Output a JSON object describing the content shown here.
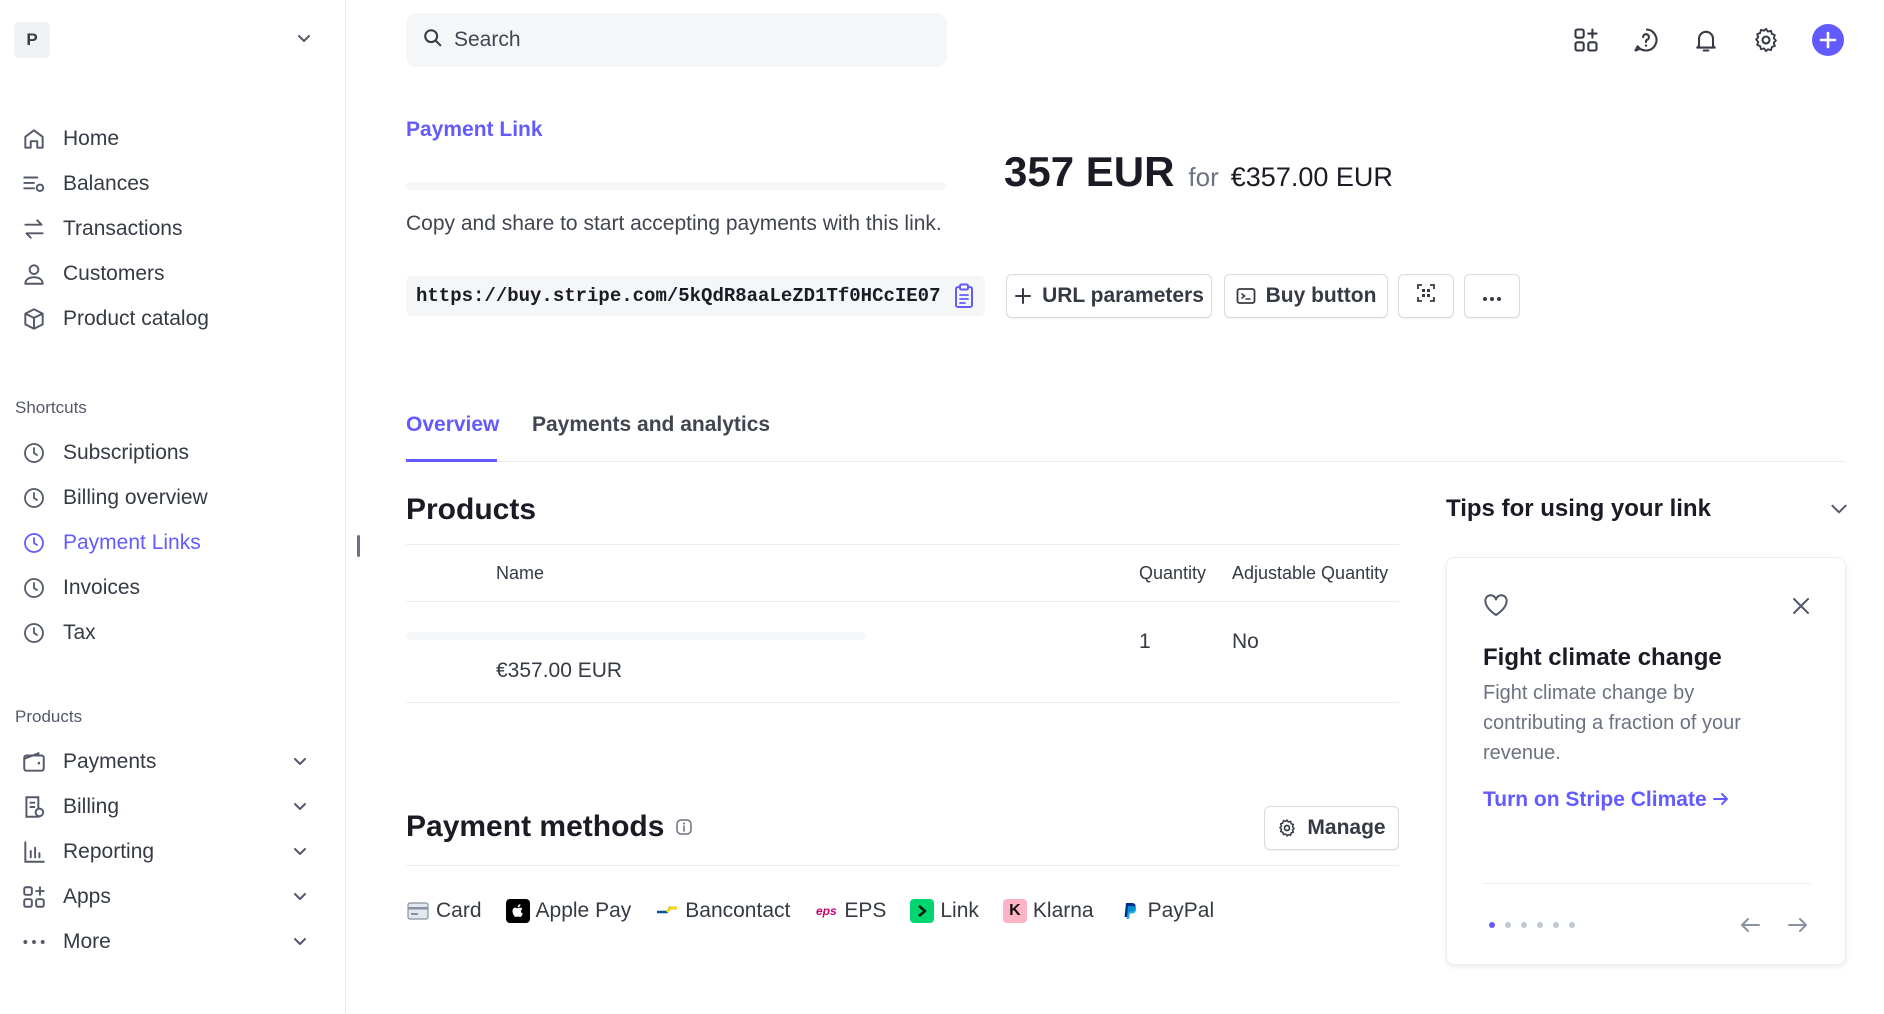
{
  "account": {
    "initial": "P"
  },
  "nav": {
    "main": [
      {
        "id": "home",
        "label": "Home",
        "icon": "home-icon"
      },
      {
        "id": "balances",
        "label": "Balances",
        "icon": "balances-icon"
      },
      {
        "id": "transactions",
        "label": "Transactions",
        "icon": "transactions-icon"
      },
      {
        "id": "customers",
        "label": "Customers",
        "icon": "customer-icon"
      },
      {
        "id": "product-catalog",
        "label": "Product catalog",
        "icon": "box-icon"
      }
    ],
    "shortcuts_heading": "Shortcuts",
    "shortcuts": [
      {
        "id": "subscriptions",
        "label": "Subscriptions",
        "icon": "clock-icon"
      },
      {
        "id": "billing-overview",
        "label": "Billing overview",
        "icon": "clock-icon"
      },
      {
        "id": "payment-links",
        "label": "Payment Links",
        "icon": "clock-icon",
        "active": true
      },
      {
        "id": "invoices",
        "label": "Invoices",
        "icon": "clock-icon"
      },
      {
        "id": "tax",
        "label": "Tax",
        "icon": "clock-icon"
      }
    ],
    "products_heading": "Products",
    "products": [
      {
        "id": "payments",
        "label": "Payments",
        "icon": "wallet-icon"
      },
      {
        "id": "billing",
        "label": "Billing",
        "icon": "billing-icon"
      },
      {
        "id": "reporting",
        "label": "Reporting",
        "icon": "bar-chart-icon"
      },
      {
        "id": "apps",
        "label": "Apps",
        "icon": "apps-icon"
      },
      {
        "id": "more",
        "label": "More",
        "icon": "more-dots-icon"
      }
    ]
  },
  "search": {
    "placeholder": "Search"
  },
  "header": {
    "eyebrow": "Payment Link",
    "title": "357 EUR",
    "for_word": "for",
    "price": "€357.00 EUR",
    "subtitle": "Copy and share to start accepting payments with this link."
  },
  "link": {
    "url": "https://buy.stripe.com/5kQdR8aaLeZD1Tf0HCcIE07",
    "url_params_label": "URL parameters",
    "buy_button_label": "Buy button"
  },
  "tabs": [
    {
      "label": "Overview",
      "active": true
    },
    {
      "label": "Payments and analytics",
      "active": false
    }
  ],
  "products": {
    "heading": "Products",
    "columns": {
      "name": "Name",
      "quantity": "Quantity",
      "adjustable": "Adjustable Quantity"
    },
    "rows": [
      {
        "price": "€357.00 EUR",
        "quantity": "1",
        "adjustable": "No"
      }
    ]
  },
  "payment_methods": {
    "heading": "Payment methods",
    "manage_label": "Manage",
    "items": [
      {
        "label": "Card",
        "icon": "card-icon"
      },
      {
        "label": "Apple Pay",
        "icon": "apple-pay-icon"
      },
      {
        "label": "Bancontact",
        "icon": "bancontact-icon"
      },
      {
        "label": "EPS",
        "icon": "eps-icon"
      },
      {
        "label": "Link",
        "icon": "link-icon"
      },
      {
        "label": "Klarna",
        "icon": "klarna-icon"
      },
      {
        "label": "PayPal",
        "icon": "paypal-icon"
      }
    ]
  },
  "tips": {
    "heading": "Tips for using your link",
    "card": {
      "title": "Fight climate change",
      "body": "Fight climate change by contributing a fraction of your revenue.",
      "link_label": "Turn on Stripe Climate",
      "total_slides": 6,
      "current_slide": 1
    }
  },
  "colors": {
    "accent": "#635bff",
    "text": "#353a44",
    "muted": "#6c7280",
    "border": "#ebeef1"
  }
}
